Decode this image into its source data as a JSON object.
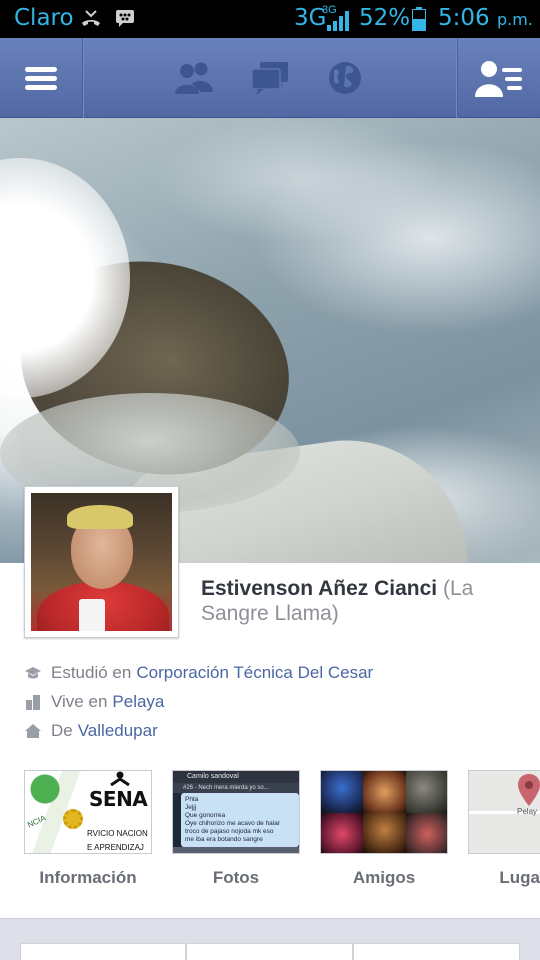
{
  "status_bar": {
    "carrier": "Claro",
    "network": "3G",
    "network_sup": "3G",
    "battery": "52%",
    "time": "5:06",
    "ampm": "p.m."
  },
  "nav": {
    "icons": [
      "menu-icon",
      "friend-requests-icon",
      "messages-icon",
      "notifications-globe-icon",
      "friends-list-icon"
    ]
  },
  "profile": {
    "name": "Estivenson Añez Cianci",
    "alias": "(La Sangre Llama)"
  },
  "info": [
    {
      "icon": "education-icon",
      "prefix": "Estudió en",
      "value": "Corporación Técnica Del Cesar"
    },
    {
      "icon": "city-icon",
      "prefix": "Vive en",
      "value": "Pelaya"
    },
    {
      "icon": "home-icon",
      "prefix": "De",
      "value": "Valledupar"
    }
  ],
  "tiles": {
    "info": {
      "label": "Información",
      "logo_text": "SENA",
      "sub1": "RVICIO NACION",
      "sub2": "E APRENDIZAJ",
      "side_text": "NCIA"
    },
    "fotos": {
      "label": "Fotos",
      "header": "Camilo sandoval",
      "sub": "#26 - Nech mera mierda yo so...",
      "lines": [
        "Phta",
        "Jejjj",
        "Que gonorrea",
        "Oye chihorizo me acavo de halar",
        "troco de pajaso nojoda mk eso",
        "me iba era botando sangre"
      ]
    },
    "amigos": {
      "label": "Amigos"
    },
    "lugares": {
      "label": "Luga",
      "map_label": "Pelay"
    }
  },
  "colors": {
    "status_text": "#33b5e5",
    "nav_bg": "#5b75b0",
    "link": "#4b67a1"
  }
}
